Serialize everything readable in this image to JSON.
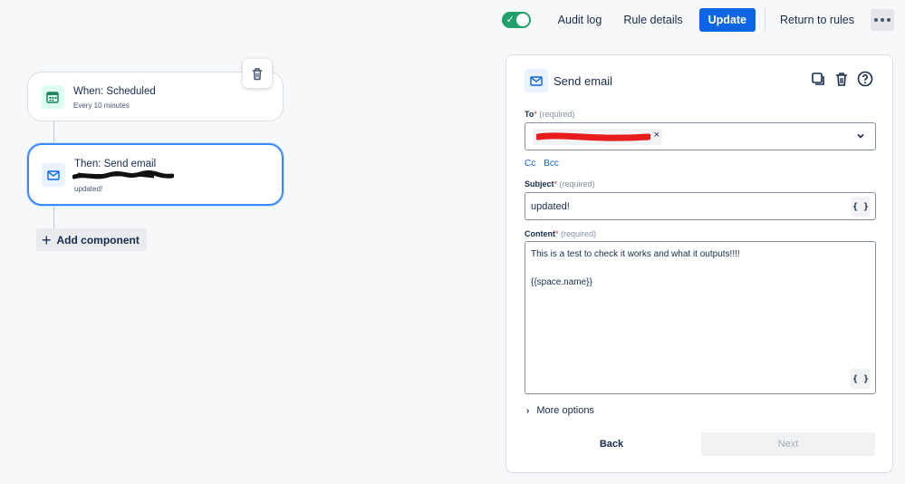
{
  "topbar": {
    "toggle_state": "on",
    "audit_log": "Audit log",
    "rule_details": "Rule details",
    "update": "Update",
    "return_to_rules": "Return to rules",
    "more_icon": "ellipsis-icon"
  },
  "canvas": {
    "trigger": {
      "title": "When: Scheduled",
      "subtitle": "Every 10 minutes",
      "icon": "calendar-icon"
    },
    "action": {
      "title": "Then: Send email",
      "subtitle": "updated!",
      "icon": "mail-icon"
    },
    "delete_icon": "trash-icon",
    "add_component": "Add component"
  },
  "panel": {
    "title": "Send email",
    "icons": [
      "copy-icon",
      "trash-icon",
      "help-icon"
    ],
    "to": {
      "label": "To",
      "asterisk": "*",
      "required": "(required)",
      "chip_remove": "×"
    },
    "cc": "Cc",
    "bcc": "Bcc",
    "subject": {
      "label": "Subject",
      "asterisk": "*",
      "required": "(required)",
      "value": "updated!"
    },
    "content": {
      "label": "Content",
      "asterisk": "*",
      "required": "(required)",
      "line1": "This is a test to check it works and what it outputs!!!!",
      "line2": "{{space.name}}"
    },
    "var_button": "{ }",
    "more_options": "More options",
    "back": "Back",
    "next": "Next"
  },
  "colors": {
    "accent": "#0c66e4",
    "toggle_on": "#22a06b",
    "selected_border": "#388bff"
  }
}
